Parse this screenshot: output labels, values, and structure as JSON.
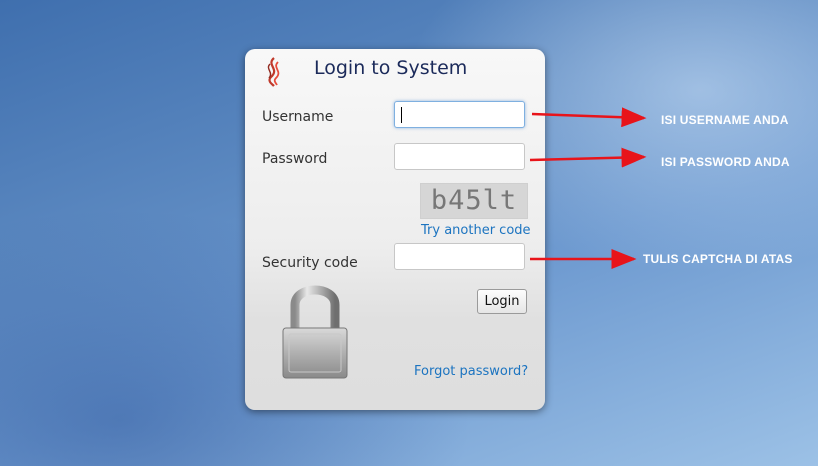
{
  "login": {
    "title": "Login to System",
    "username_label": "Username",
    "password_label": "Password",
    "captcha_text": "b45lt",
    "try_another": "Try another code",
    "security_label": "Security code",
    "login_button": "Login",
    "forgot": "Forgot password?"
  },
  "annotations": {
    "username": "ISI USERNAME ANDA",
    "password": "ISI PASSWORD ANDA",
    "captcha": "TULIS CAPTCHA DI ATAS"
  },
  "icons": {
    "logo": "flame-logo-icon",
    "lock": "padlock-icon"
  },
  "colors": {
    "title": "#1b2a5a",
    "link": "#1c74c0",
    "arrow": "#e8141a"
  }
}
